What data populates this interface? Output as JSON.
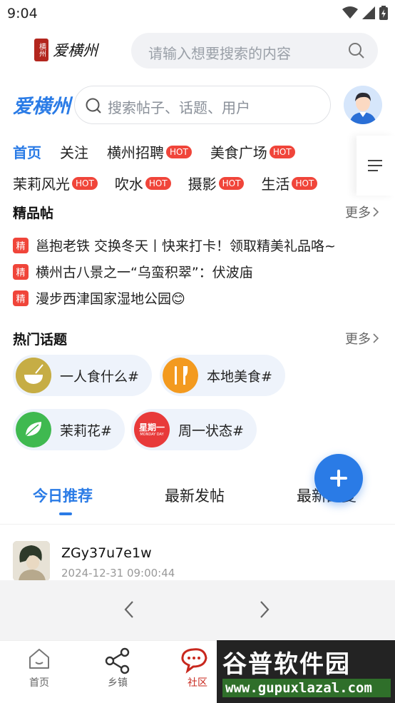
{
  "status_bar": {
    "time": "9:04"
  },
  "app_header": {
    "logo_text": "爱横州",
    "logo_seal": "横州",
    "search_placeholder": "请输入想要搜索的内容"
  },
  "sub_header": {
    "brand": "爱横州",
    "search_placeholder": "搜索帖子、话题、用户"
  },
  "tabs": {
    "row1": [
      {
        "label": "首页",
        "hot": false,
        "active": true
      },
      {
        "label": "关注",
        "hot": false
      },
      {
        "label": "横州招聘",
        "hot": true
      },
      {
        "label": "美食广场",
        "hot": true
      }
    ],
    "row2": [
      {
        "label": "茉莉风光",
        "hot": true
      },
      {
        "label": "吹水",
        "hot": true
      },
      {
        "label": "摄影",
        "hot": true
      },
      {
        "label": "生活",
        "hot": true
      }
    ],
    "hot_badge": "HOT"
  },
  "featured": {
    "title": "精品帖",
    "more": "更多",
    "badge": "精",
    "posts": [
      "邕抱老铁 交换冬天丨快来打卡！领取精美礼品咯~",
      "横州古八景之一“乌蛮积翠”：伏波庙",
      "漫步西津国家湿地公园😊"
    ]
  },
  "topics": {
    "title": "热门话题",
    "more": "更多",
    "items": [
      {
        "label": "一人食什么#",
        "icon": "bowl-icon"
      },
      {
        "label": "本地美食#",
        "icon": "fork-knife-icon"
      },
      {
        "label": "茉莉花#",
        "icon": "leaf-icon"
      },
      {
        "label": "周一状态#",
        "icon": "calendar-icon",
        "icon_text": "星期一",
        "icon_sub": "MONDAY DAY"
      }
    ]
  },
  "feed_tabs": [
    {
      "label": "今日推荐",
      "active": true
    },
    {
      "label": "最新发帖"
    },
    {
      "label": "最新回复"
    }
  ],
  "feed": {
    "username": "ZGy37u7e1w",
    "time": "2024-12-31 09:00:44"
  },
  "bottom_nav": [
    {
      "label": "首页",
      "icon": "home-icon"
    },
    {
      "label": "乡镇",
      "icon": "share-icon"
    },
    {
      "label": "社区",
      "icon": "chat-icon",
      "active": true
    }
  ],
  "watermark": {
    "title": "谷普软件园",
    "url": "www.gupuxlazal.com"
  },
  "colors": {
    "accent": "#2a7be6",
    "hot": "#f0453a",
    "brand_red": "#c8281e"
  }
}
